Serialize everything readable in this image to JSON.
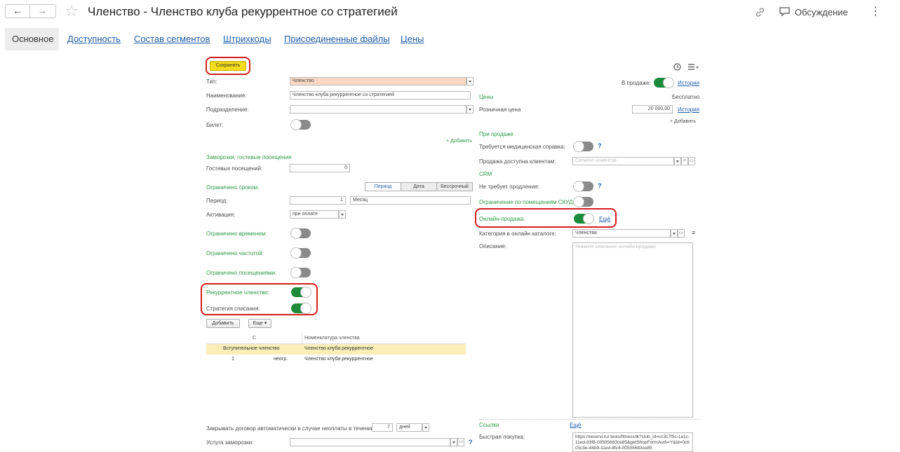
{
  "title": "Членство - Членство клуба рекуррентное со стратегией",
  "discussion_label": "Обсуждение",
  "tabs": [
    "Основное",
    "Доступность",
    "Состав сегментов",
    "Штрихкоды",
    "Присоединенные файлы",
    "Цены"
  ],
  "save_label": "Сохранить",
  "left": {
    "type_label": "Тип:",
    "type_value": "Членство",
    "name_label": "Наименование:",
    "name_value": "Членство клуба рекуррентное со стратегией",
    "division_label": "Подразделение:",
    "ticket_label": "Билет:",
    "add_label": "+ Добавить",
    "freeze_header": "Заморозки, гостевые посещения",
    "guest_label": "Гостевых посещений:",
    "guest_value": "0",
    "limited_term": "Ограничено сроком:",
    "seg_period": "Период",
    "seg_date": "Дата",
    "seg_unlimited": "Бессрочный",
    "period_label": "Период:",
    "period_value": "1",
    "period_unit": "Месяц",
    "activation_label": "Активация:",
    "activation_value": "при оплате",
    "limited_time": "Ограничено временем:",
    "limited_freq": "Ограничено частотой:",
    "limited_visits": "Ограничено посещениями:",
    "recurrent_label": "Рекуррентное членство:",
    "strategy_label": "Стратегия списания:",
    "add_button": "Добавить",
    "more_button": "Еще",
    "col_from": "С",
    "col_nomen": "Номенклатура членства",
    "rows": [
      {
        "from": "Вступительное членство",
        "qty": "",
        "nomen": "Членство клуба рекуррентное"
      },
      {
        "from": "1",
        "qty": "неогр.",
        "nomen": "Членство клуба рекуррентное"
      }
    ],
    "autoclose_label": "Закрывать договор автоматически в случае неоплаты в течении",
    "autoclose_value": "7",
    "autoclose_unit": "дней",
    "freeze_service_label": "Услуга заморозки:"
  },
  "right": {
    "on_sale_label": "В продаже:",
    "history_label": "История",
    "prices_header": "Цены",
    "free_label": "Бесплатно",
    "retail_label": "Розничная цена",
    "retail_value": "20 000,00",
    "add_label": "+ Добавить",
    "on_sale_header": "При продаже",
    "med_label": "Требуется медицинская справка:",
    "avail_label": "Продажа доступна клиентам:",
    "segment_placeholder": "Сегмент клиентов",
    "crm_header": "CRM",
    "no_renew_label": "Не требует продления:",
    "skud_label": "Ограничение по помещениям СКУД:",
    "online_label": "Онлайн-продажа:",
    "more_link": "Ещё",
    "category_label": "Категория в онлайн каталоге:",
    "category_value": "Членства",
    "desc_label": "Описание:",
    "desc_placeholder": "Укажите описание онлайн продажи",
    "links_header": "Ссылки",
    "links_more": "Ещё",
    "quick_label": "Быстрая покупка:",
    "quick_value": "https://reservi.ru/  tests/fitness/lk?club_id=cc3c7f5c-1a1c-11ed-83f8-00505683ce85&getShopFormAuth=Y&id=0cbc5c3e-44b9-11ed-8fc4-00505683ce85"
  },
  "colors": {
    "accent_green": "#1e8a3c",
    "link_blue": "#1f5fa8",
    "highlight_red": "#d31d1d",
    "save_yellow": "#f5dc1a"
  },
  "icons": [
    "back-arrow-icon",
    "forward-arrow-icon",
    "star-icon",
    "link-icon",
    "discussion-icon",
    "kebab-menu-icon",
    "history-clock-icon",
    "list-menu-icon",
    "help-icon"
  ]
}
